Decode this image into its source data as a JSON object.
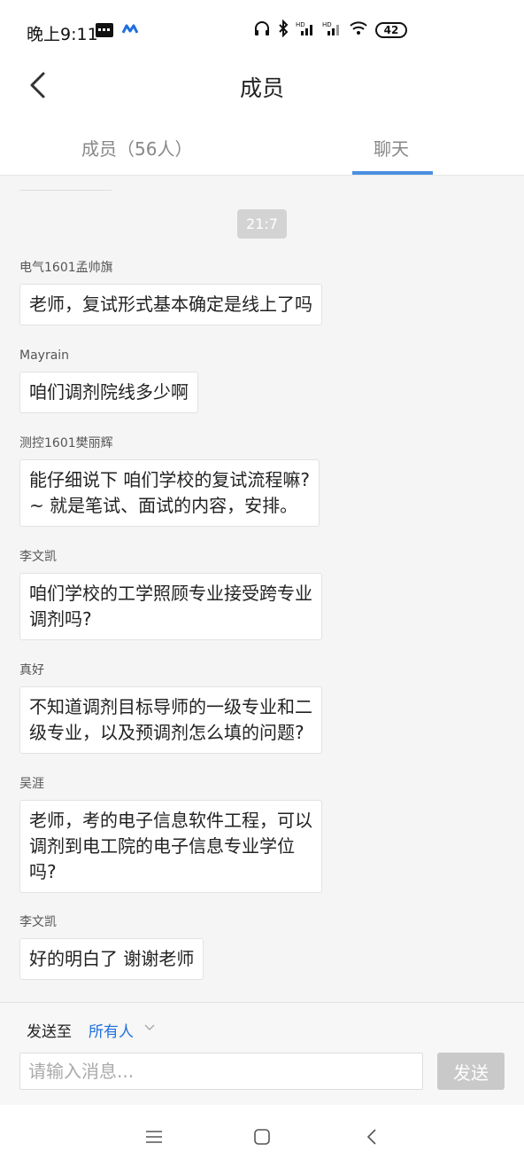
{
  "status_bar": {
    "time": "晚上9:11",
    "battery": "42",
    "icons": [
      "message-icon",
      "app-icon",
      "headphones-icon",
      "bluetooth-icon",
      "signal-icon",
      "signal-icon",
      "wifi-icon",
      "battery-icon"
    ]
  },
  "nav": {
    "title": "成员",
    "back_icon": "chevron-left-icon"
  },
  "tabs": [
    {
      "label": "成员（56人）",
      "active": false
    },
    {
      "label": "聊天",
      "active": true
    }
  ],
  "chat": {
    "timestamp": "21:7",
    "messages": [
      {
        "sender": "电气1601孟帅旗",
        "text": "老师，复试形式基本确定是线上了吗"
      },
      {
        "sender": "Mayrain",
        "text": "咱们调剂院线多少啊"
      },
      {
        "sender": "测控1601樊丽辉",
        "text": "能仔细说下 咱们学校的复试流程嘛?\n~ 就是笔试、面试的内容，安排。"
      },
      {
        "sender": "李文凯",
        "text": "咱们学校的工学照顾专业接受跨专业\n调剂吗?"
      },
      {
        "sender": "真好",
        "text": "不知道调剂目标导师的一级专业和二\n级专业，以及预调剂怎么填的问题?"
      },
      {
        "sender": "吴涯",
        "text": "老师，考的电子信息软件工程，可以\n调剂到电工院的电子信息专业学位\n吗?"
      },
      {
        "sender": "李文凯",
        "text": "好的明白了 谢谢老师"
      }
    ]
  },
  "composer": {
    "send_to_label": "发送至",
    "send_to_target": "所有人",
    "input_placeholder": "请输入消息...",
    "send_label": "发送"
  },
  "colors": {
    "accent": "#1e6fe0",
    "tab_indicator": "#4a8fe0",
    "chat_bg": "#f5f5f5",
    "send_disabled": "#c9c9c9"
  }
}
